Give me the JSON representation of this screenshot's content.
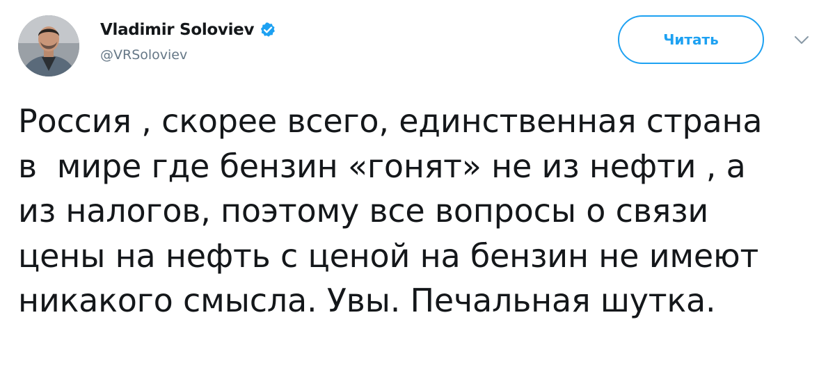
{
  "author": {
    "display_name": "Vladimir Soloviev",
    "handle": "@VRSoloviev",
    "verified": true,
    "avatar_icon": "user-avatar-photo"
  },
  "actions": {
    "follow_label": "Читать",
    "menu_icon": "chevron-down-icon"
  },
  "tweet": {
    "text": "Россия , скорее всего, единственная страна\nв  мире где бензин «гонят» не из нефти , а\nиз налогов, поэтому все вопросы о связи\nцены на нефть с ценой на бензин не имеют\nникакого смысла. Увы. Печальная шутка."
  },
  "colors": {
    "accent": "#1da1f2",
    "text": "#14171a",
    "secondary_text": "#657786"
  }
}
